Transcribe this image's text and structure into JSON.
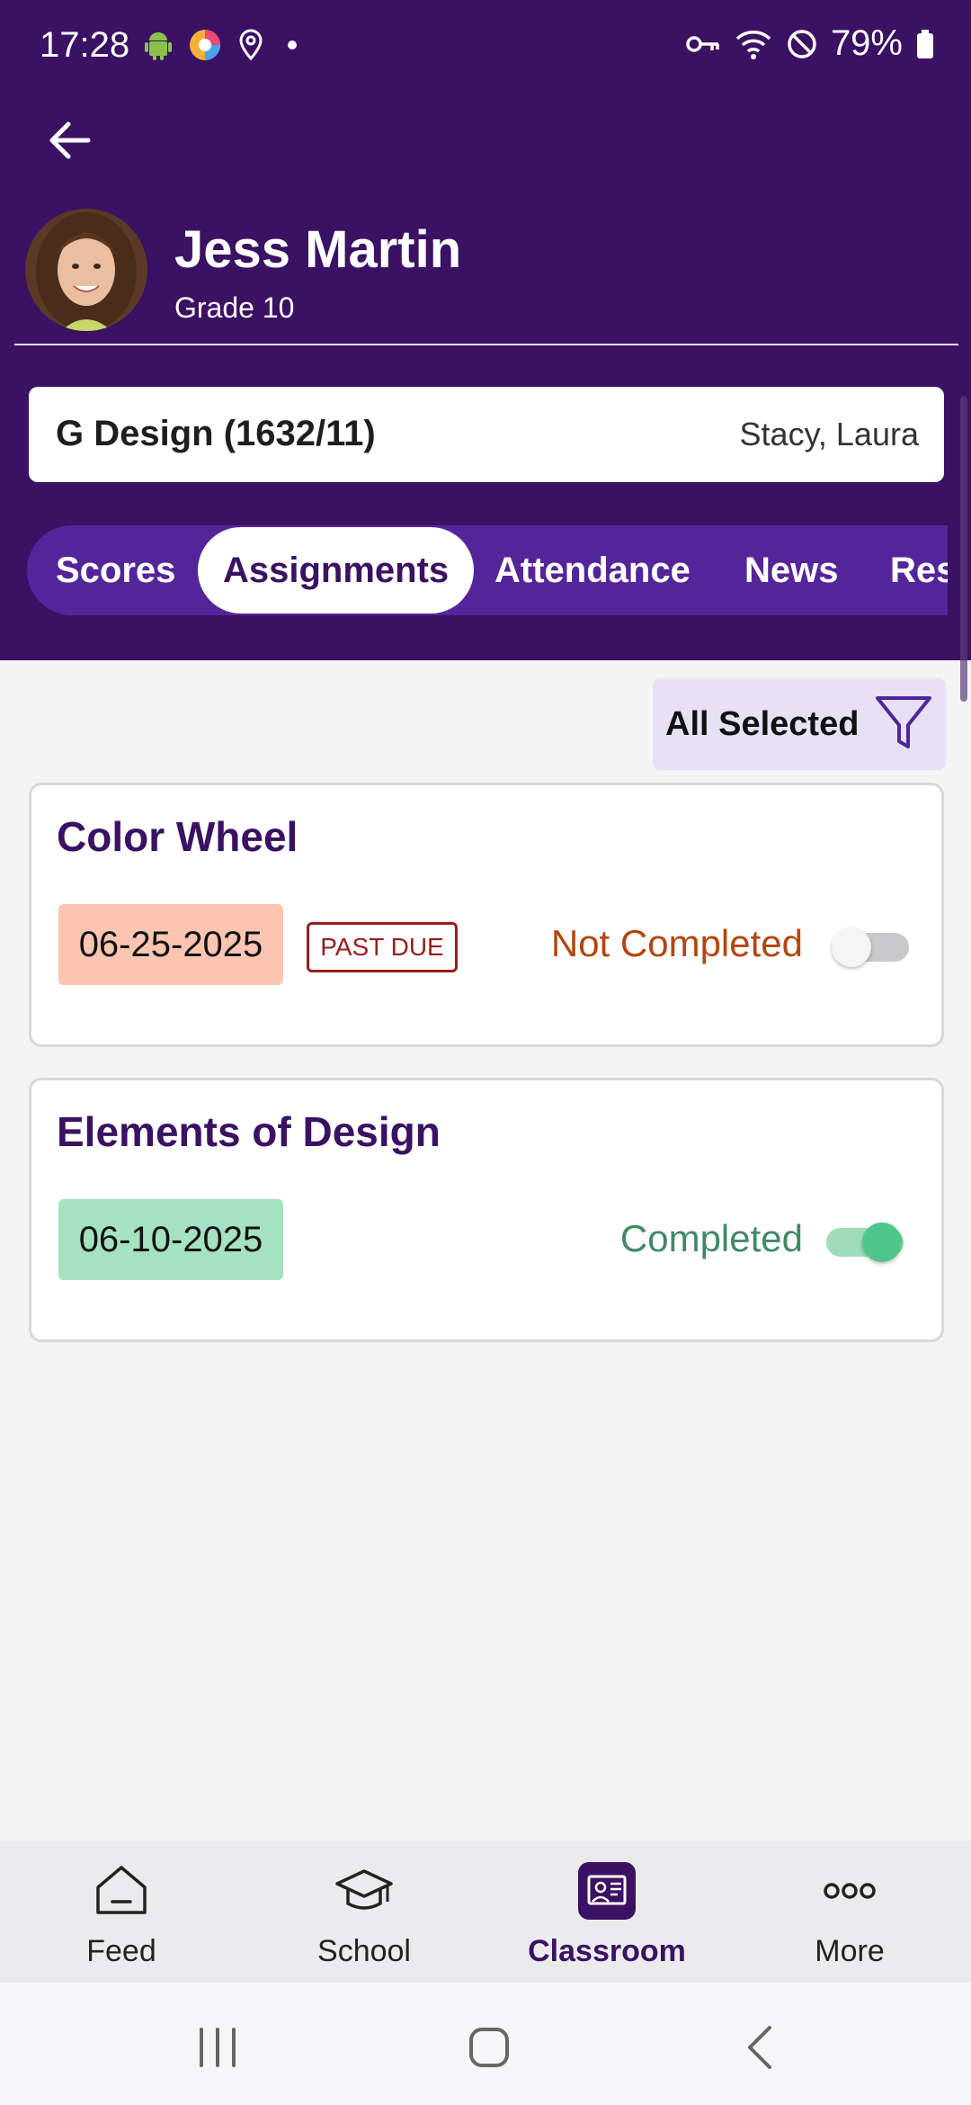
{
  "status_bar": {
    "time": "17:28",
    "battery": "79%",
    "left_icons": [
      "android-icon",
      "browser-icon",
      "location-icon",
      "dot-icon"
    ],
    "right_icons": [
      "vpn-key-icon",
      "wifi-icon",
      "do-not-disturb-icon",
      "battery-icon"
    ]
  },
  "header": {
    "student_name": "Jess Martin",
    "student_grade": "Grade 10",
    "class_name": "G Design (1632/11)",
    "class_teacher": "Stacy, Laura"
  },
  "tabs": [
    {
      "label": "Scores",
      "active": false
    },
    {
      "label": "Assignments",
      "active": true
    },
    {
      "label": "Attendance",
      "active": false
    },
    {
      "label": "News",
      "active": false
    },
    {
      "label": "Res",
      "active": false
    }
  ],
  "filter": {
    "label": "All Selected",
    "icon": "filter-icon"
  },
  "assignments": [
    {
      "title": "Color Wheel",
      "date": "06-25-2025",
      "badge": "PAST DUE",
      "status": "Not Completed",
      "completed": false
    },
    {
      "title": "Elements of Design",
      "date": "06-10-2025",
      "badge": "",
      "status": "Completed",
      "completed": true
    }
  ],
  "bottom_nav": [
    {
      "label": "Feed",
      "icon": "home-icon",
      "active": false
    },
    {
      "label": "School",
      "icon": "graduation-cap-icon",
      "active": false
    },
    {
      "label": "Classroom",
      "icon": "classroom-icon",
      "active": true
    },
    {
      "label": "More",
      "icon": "more-icon",
      "active": false
    }
  ],
  "colors": {
    "brand": "#3b1163",
    "tab_bar": "#54259a",
    "past_due": "#9c1c1c",
    "not_completed_text": "#b5450f",
    "completed_text": "#3f8a63",
    "toggle_on": "#4fc68a"
  }
}
